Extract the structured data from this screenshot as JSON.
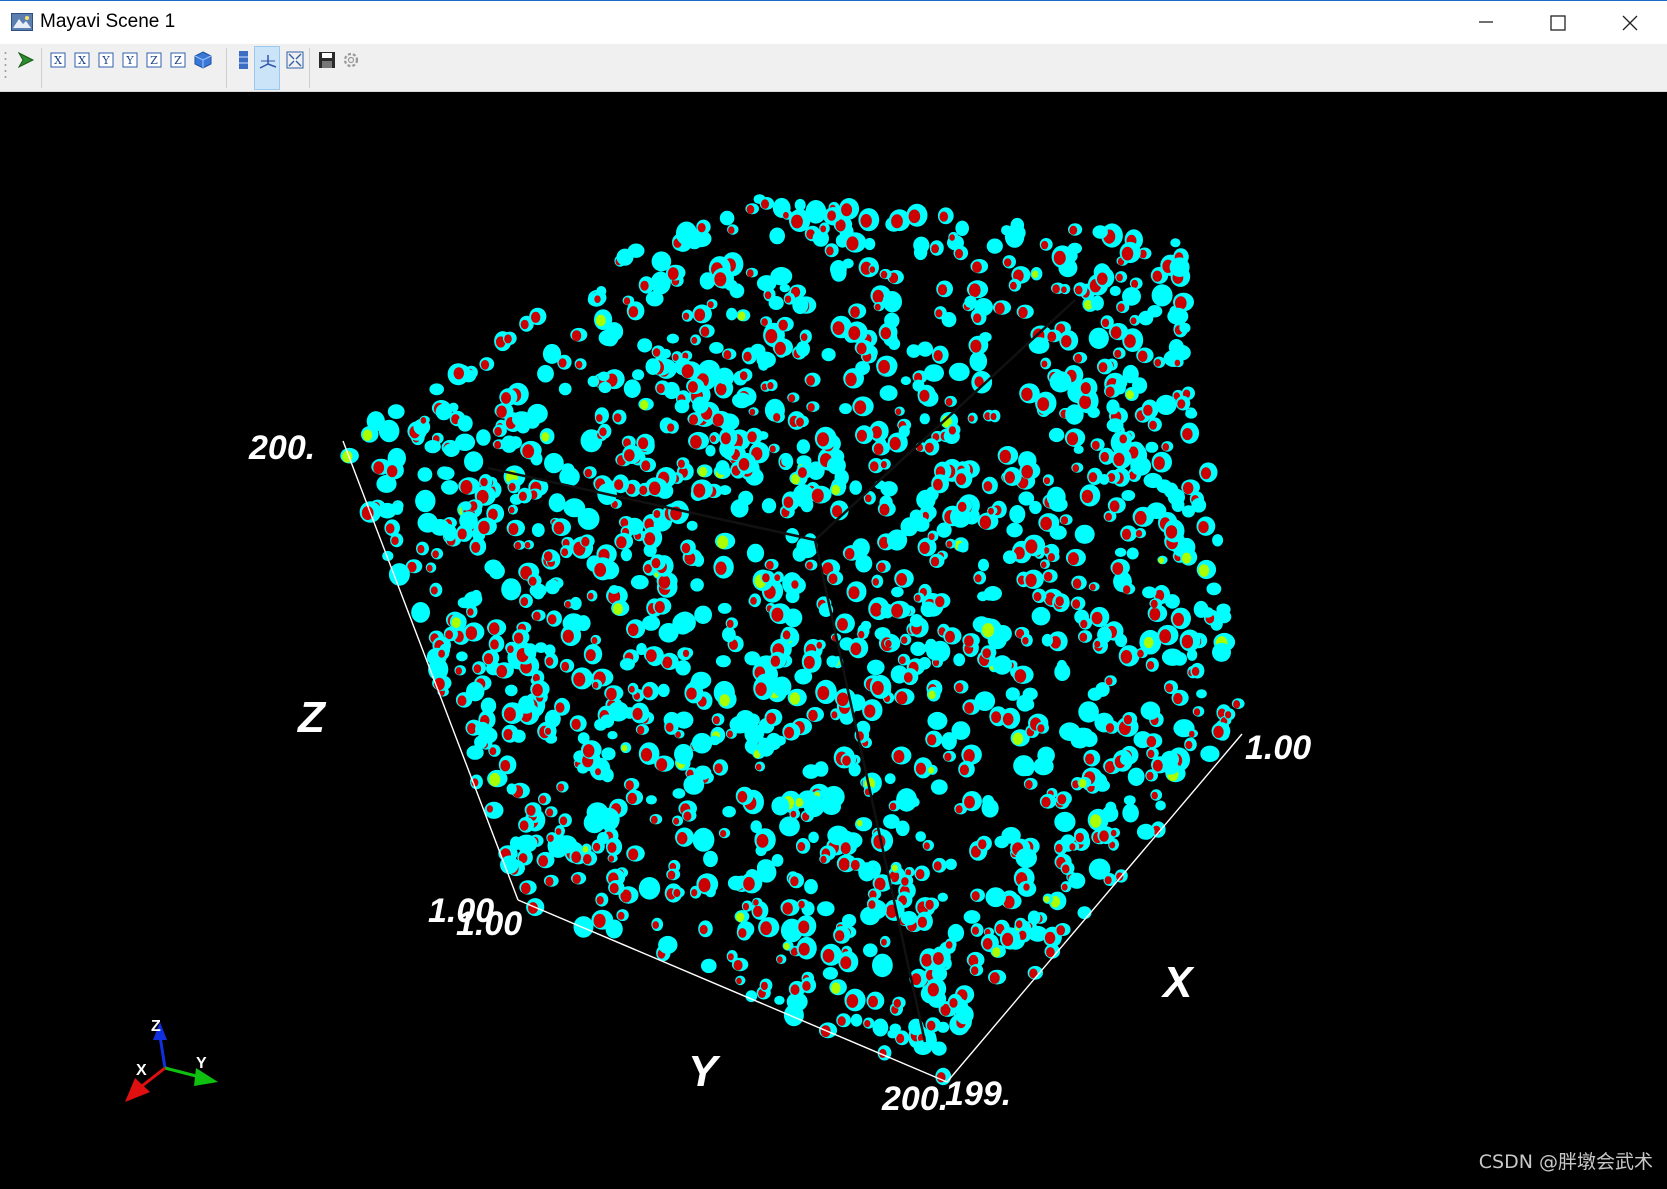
{
  "window": {
    "title": "Mayavi Scene 1",
    "icon": "mayavi-scene-icon",
    "controls": [
      "minimize-icon",
      "maximize-icon",
      "close-icon"
    ]
  },
  "toolbar": {
    "groups": [
      [
        "mayavi-pipeline-icon"
      ],
      [
        "view-x-plus-icon",
        "view-x-minus-icon",
        "view-y-plus-icon",
        "view-y-minus-icon",
        "view-z-plus-icon",
        "view-z-minus-icon",
        "isometric-view-icon"
      ],
      [
        "parallel-projection-icon",
        "toggle-axes-indicator-icon",
        "full-screen-icon"
      ],
      [
        "save-icon",
        "configure-scene-icon"
      ]
    ],
    "active": "toggle-axes-indicator-icon"
  },
  "scene": {
    "background": "#000000",
    "blob_colors": {
      "surface": "#00ffff",
      "cut": "#cc0000",
      "highlight": "#aaff00"
    },
    "axes": {
      "z": {
        "label": "Z",
        "tick_top": "200.",
        "tick_bottom": "1.00"
      },
      "y": {
        "label": "Y",
        "tick_start": "1.00",
        "tick_end": "200."
      },
      "x": {
        "label": "X",
        "tick_start": "1.00",
        "tick_end": "199."
      }
    },
    "orientation_axes": {
      "x": "X",
      "y": "Y",
      "z": "Z",
      "colors": {
        "x": "#e01010",
        "y": "#10c010",
        "z": "#1030e0"
      }
    }
  },
  "watermark": "CSDN @胖墩会武术"
}
